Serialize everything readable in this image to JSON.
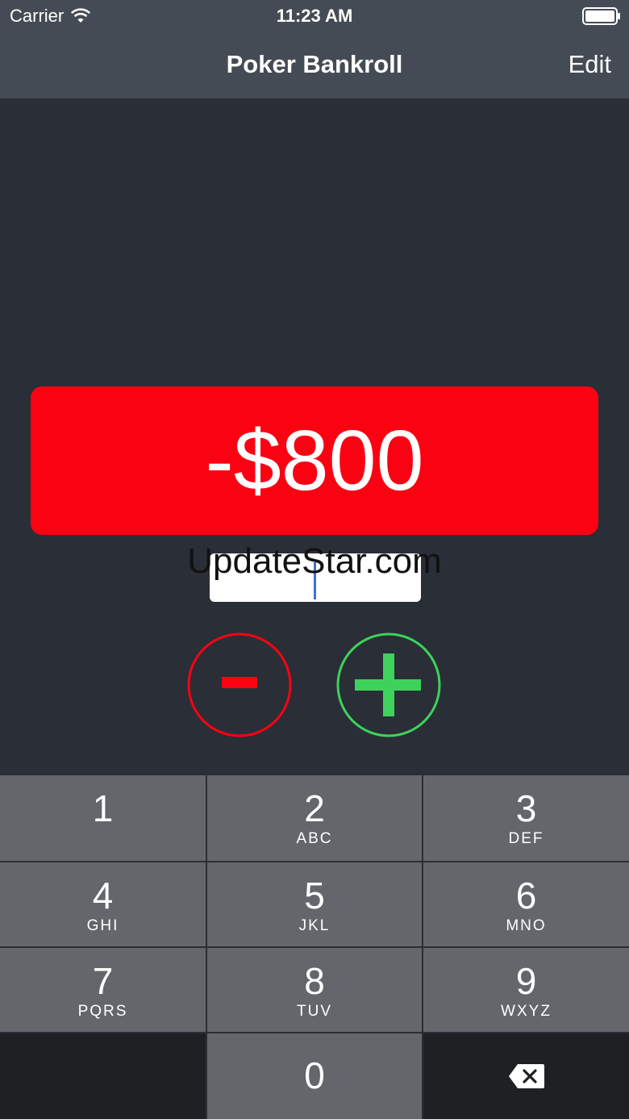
{
  "status_bar": {
    "carrier": "Carrier",
    "time": "11:23 AM"
  },
  "nav": {
    "title": "Poker Bankroll",
    "edit_label": "Edit"
  },
  "bankroll": {
    "amount": "-$800",
    "color": "#fb0213"
  },
  "amount_input": {
    "value": ""
  },
  "watermark": "UpdateStar.com",
  "actions": {
    "minus_color": "#fb0213",
    "plus_color": "#3dd35b"
  },
  "keypad": {
    "keys": [
      {
        "num": "1",
        "letters": ""
      },
      {
        "num": "2",
        "letters": "ABC"
      },
      {
        "num": "3",
        "letters": "DEF"
      },
      {
        "num": "4",
        "letters": "GHI"
      },
      {
        "num": "5",
        "letters": "JKL"
      },
      {
        "num": "6",
        "letters": "MNO"
      },
      {
        "num": "7",
        "letters": "PQRS"
      },
      {
        "num": "8",
        "letters": "TUV"
      },
      {
        "num": "9",
        "letters": "WXYZ"
      },
      {
        "num": "0",
        "letters": ""
      }
    ]
  }
}
